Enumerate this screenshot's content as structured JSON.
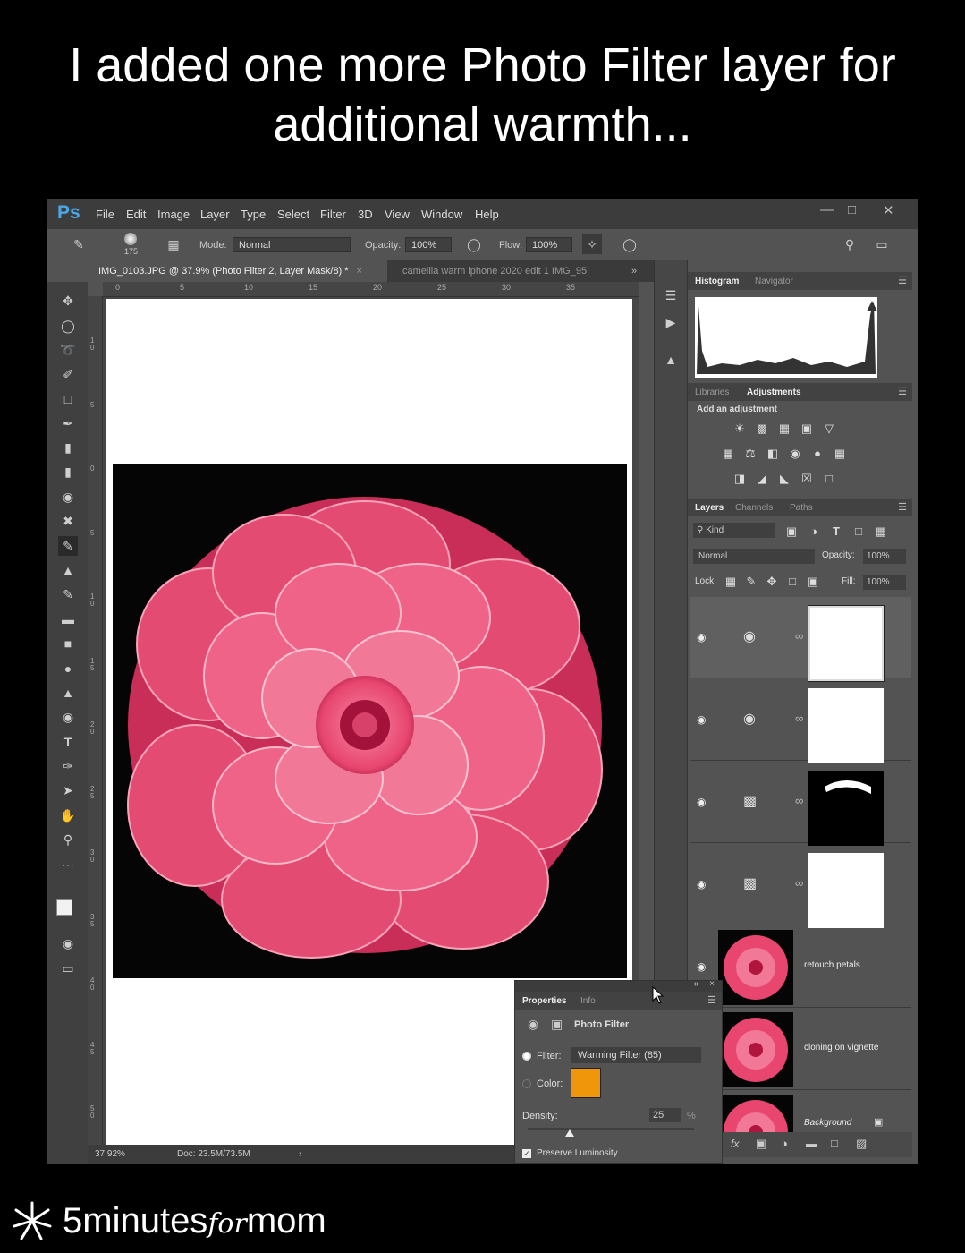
{
  "headline": {
    "line1": "I added one more Photo Filter layer for",
    "line2": "additional warmth..."
  },
  "app": {
    "logo": "Ps",
    "menu": [
      "File",
      "Edit",
      "Image",
      "Layer",
      "Type",
      "Select",
      "Filter",
      "3D",
      "View",
      "Window",
      "Help"
    ]
  },
  "options_bar": {
    "brush_size": "175",
    "mode_label": "Mode:",
    "mode_value": "Normal",
    "opacity_label": "Opacity:",
    "opacity_value": "100%",
    "flow_label": "Flow:",
    "flow_value": "100%"
  },
  "doc_tabs": [
    {
      "label": "IMG_0103.JPG @ 37.9% (Photo Filter 2, Layer Mask/8) *",
      "active": true
    },
    {
      "label": "camellia warm iphone 2020 edit 1 IMG_95",
      "active": false
    }
  ],
  "ruler_top": [
    "0",
    "5",
    "10",
    "15",
    "20",
    "25",
    "30",
    "35"
  ],
  "ruler_left": [
    "1 0",
    "5",
    "0",
    "5",
    "1 0",
    "1 5",
    "2 0",
    "2 5",
    "3 0",
    "3 5",
    "4 0",
    "4 5",
    "5 0"
  ],
  "status": {
    "zoom": "37.92%",
    "doc": "Doc: 23.5M/73.5M"
  },
  "histogram_panel": {
    "tabs": [
      "Histogram",
      "Navigator"
    ]
  },
  "adjustments_panel": {
    "tabs": [
      "Libraries",
      "Adjustments"
    ],
    "heading": "Add an adjustment"
  },
  "layers_panel": {
    "tabs": [
      "Layers",
      "Channels",
      "Paths"
    ],
    "kind_filter": "Kind",
    "blend_mode": "Normal",
    "opacity_label": "Opacity:",
    "opacity_value": "100%",
    "lock_label": "Lock:",
    "fill_label": "Fill:",
    "fill_value": "100%",
    "layers": [
      {
        "name": "",
        "type": "photo-filter",
        "selected": true
      },
      {
        "name": "",
        "type": "photo-filter",
        "selected": false
      },
      {
        "name": "",
        "type": "levels",
        "selected": false
      },
      {
        "name": "",
        "type": "levels",
        "selected": false
      },
      {
        "name": "retouch petals",
        "type": "pixel",
        "selected": false
      },
      {
        "name": "cloning on vignette",
        "type": "pixel",
        "selected": false
      },
      {
        "name": "Background",
        "type": "pixel",
        "selected": false
      }
    ],
    "footer_fx": "fx"
  },
  "properties_panel": {
    "tabs": [
      "Properties",
      "Info"
    ],
    "title": "Photo Filter",
    "filter_label": "Filter:",
    "filter_value": "Warming Filter (85)",
    "color_label": "Color:",
    "color_value": "#f0960a",
    "density_label": "Density:",
    "density_value": "25",
    "density_unit": "%",
    "density_fraction": 0.25,
    "preserve_label": "Preserve Luminosity",
    "preserve_checked": true
  },
  "branding": {
    "digit": "5",
    "word1": "minutes",
    "word2": "for",
    "word3": "mom"
  },
  "colors": {
    "ui_bg": "#535353",
    "menubar": "#3c3c3c",
    "accent_blue": "#4aa8e6",
    "flower_pink": "#e8466f"
  }
}
